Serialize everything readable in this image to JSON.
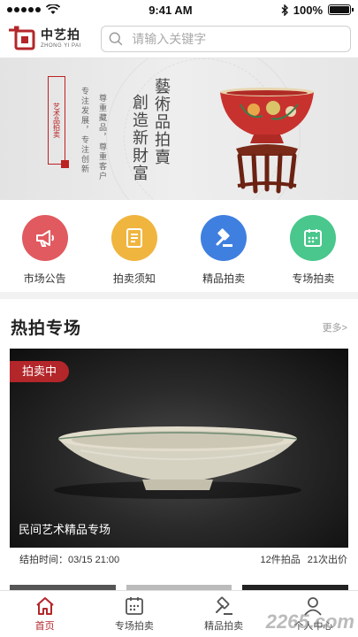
{
  "statusbar": {
    "time": "9:41 AM",
    "battery": "100%"
  },
  "header": {
    "logo_cn": "中艺拍",
    "logo_en": "ZHONG YI PAI",
    "search_placeholder": "请输入关键字"
  },
  "banner": {
    "tag": "艺术品拍卖",
    "slogan_a": "专注发展，专注创新",
    "slogan_b": "尊重藏品，尊重客户",
    "title_a": "藝術品拍賣",
    "title_b": "創造新財富"
  },
  "quick": [
    {
      "label": "市场公告",
      "icon": "megaphone-icon",
      "color": "#e05a5f"
    },
    {
      "label": "拍卖须知",
      "icon": "document-icon",
      "color": "#f0b53f"
    },
    {
      "label": "精品拍卖",
      "icon": "gavel-icon",
      "color": "#3f7fe0"
    },
    {
      "label": "专场拍卖",
      "icon": "calendar-icon",
      "color": "#49c78c"
    }
  ],
  "hot": {
    "title": "热拍专场",
    "more": "更多>",
    "card": {
      "badge": "拍卖中",
      "caption": "民间艺术精品专场",
      "end_time": "结拍时间：03/15 21:00",
      "lots": "12件拍品",
      "bids": "21次出价"
    }
  },
  "tabs": [
    {
      "label": "首页",
      "icon": "home-icon",
      "active": true
    },
    {
      "label": "专场拍卖",
      "icon": "calendar-icon",
      "active": false
    },
    {
      "label": "精品拍卖",
      "icon": "gavel-icon",
      "active": false
    },
    {
      "label": "个人中心",
      "icon": "user-icon",
      "active": false
    }
  ],
  "watermark": "2265.com",
  "colors": {
    "accent": "#b3262a"
  }
}
